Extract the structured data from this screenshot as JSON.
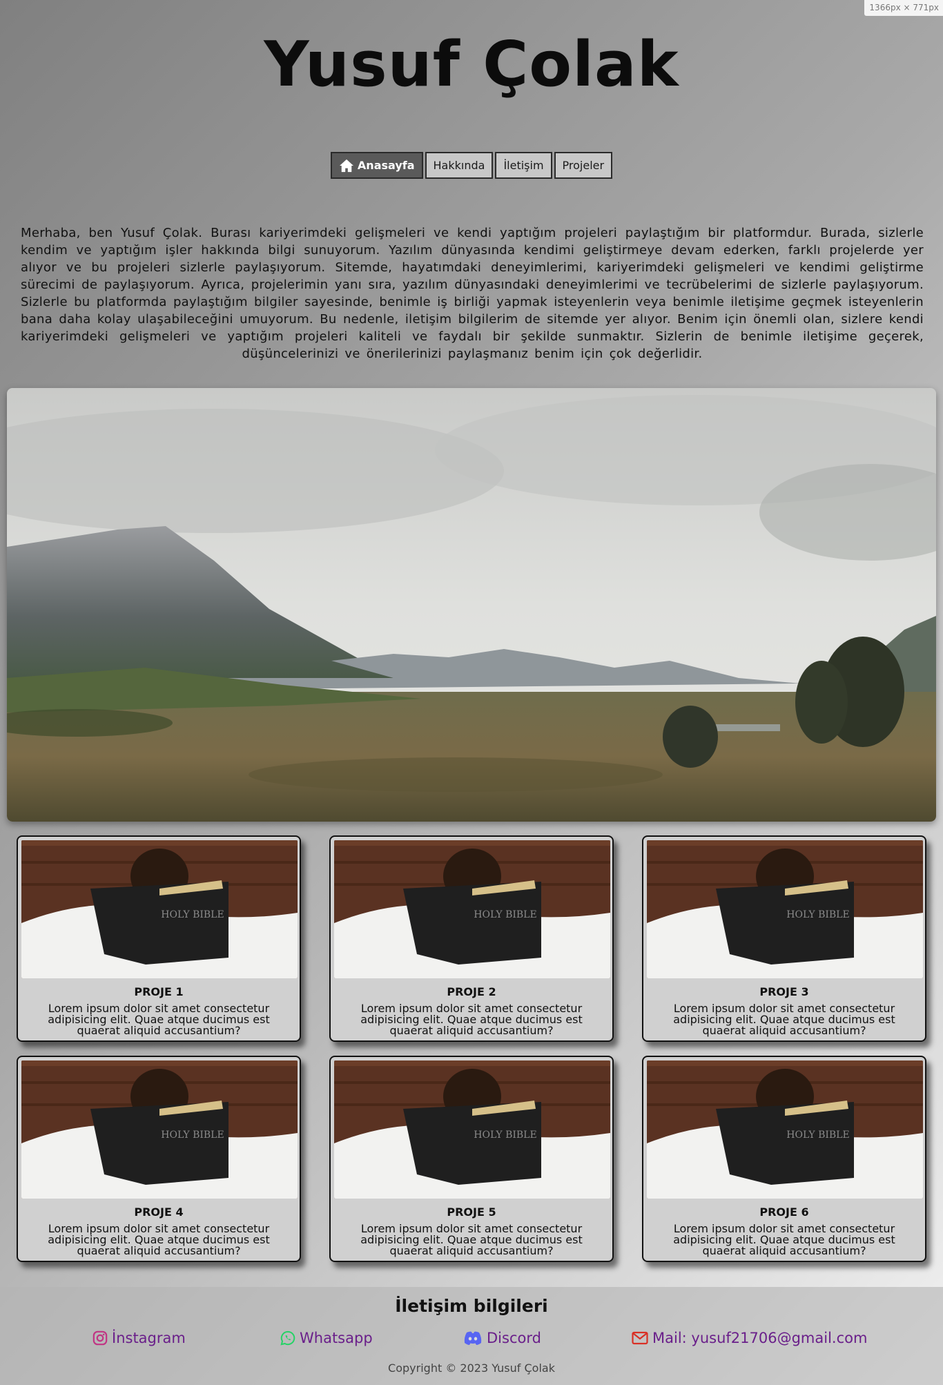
{
  "viewport_badge": "1366px × 771px",
  "site": {
    "title": "Yusuf Çolak"
  },
  "nav": [
    {
      "label": "Anasayfa",
      "icon": "home-icon",
      "active": true
    },
    {
      "label": "Hakkında"
    },
    {
      "label": "İletişim"
    },
    {
      "label": "Projeler"
    }
  ],
  "intro": "Merhaba, ben Yusuf Çolak. Burası kariyerimdeki gelişmeleri ve kendi yaptığım projeleri paylaştığım bir platformdur. Burada, sizlerle kendim ve yaptığım işler hakkında bilgi sunuyorum. Yazılım dünyasında kendimi geliştirmeye devam ederken, farklı projelerde yer alıyor ve bu projeleri sizlerle paylaşıyorum. Sitemde, hayatımdaki deneyimlerimi, kariyerimdeki gelişmeleri ve kendimi geliştirme sürecimi de paylaşıyorum. Ayrıca, projelerimin yanı sıra, yazılım dünyasındaki deneyimlerimi ve tecrübelerimi de sizlerle paylaşıyorum. Sizlerle bu platformda paylaştığım bilgiler sayesinde, benimle iş birliği yapmak isteyenlerin veya benimle iletişime geçmek isteyenlerin bana daha kolay ulaşabileceğini umuyorum. Bu nedenle, iletişim bilgilerim de sitemde yer alıyor. Benim için önemli olan, sizlere kendi kariyerimdeki gelişmeleri ve yaptığım projeleri kaliteli ve faydalı bir şekilde sunmaktır. Sizlerin de benimle iletişime geçerek, düşüncelerinizi ve önerilerinizi paylaşmanız benim için çok değerlidir.",
  "projects": [
    {
      "title": "PROJE 1",
      "text": "Lorem ipsum dolor sit amet consectetur adipisicing elit. Quae atque ducimus est quaerat aliquid accusantium?",
      "book_text": "HOLY BIBLE"
    },
    {
      "title": "PROJE 2",
      "text": "Lorem ipsum dolor sit amet consectetur adipisicing elit. Quae atque ducimus est quaerat aliquid accusantium?",
      "book_text": "HOLY BIBLE"
    },
    {
      "title": "PROJE 3",
      "text": "Lorem ipsum dolor sit amet consectetur adipisicing elit. Quae atque ducimus est quaerat aliquid accusantium?",
      "book_text": "HOLY BIBLE"
    },
    {
      "title": "PROJE 4",
      "text": "Lorem ipsum dolor sit amet consectetur adipisicing elit. Quae atque ducimus est quaerat aliquid accusantium?",
      "book_text": "HOLY BIBLE"
    },
    {
      "title": "PROJE 5",
      "text": "Lorem ipsum dolor sit amet consectetur adipisicing elit. Quae atque ducimus est quaerat aliquid accusantium?",
      "book_text": "HOLY BIBLE"
    },
    {
      "title": "PROJE 6",
      "text": "Lorem ipsum dolor sit amet consectetur adipisicing elit. Quae atque ducimus est quaerat aliquid accusantium?",
      "book_text": "HOLY BIBLE"
    }
  ],
  "footer": {
    "title": "İletişim bilgileri",
    "contacts": [
      {
        "label": "İnstagram",
        "icon": "instagram-icon",
        "color": "#c13584"
      },
      {
        "label": "Whatsapp",
        "icon": "whatsapp-icon",
        "color": "#25d366"
      },
      {
        "label": "Discord",
        "icon": "discord-icon",
        "color": "#5865f2"
      },
      {
        "label": "Mail: yusuf21706@gmail.com",
        "icon": "mail-icon",
        "color": "#d93025"
      }
    ],
    "copyright": "Copyright © 2023 Yusuf Çolak"
  },
  "colors": {
    "link": "#6a1f8a",
    "active_nav": "#5a5a5a"
  }
}
